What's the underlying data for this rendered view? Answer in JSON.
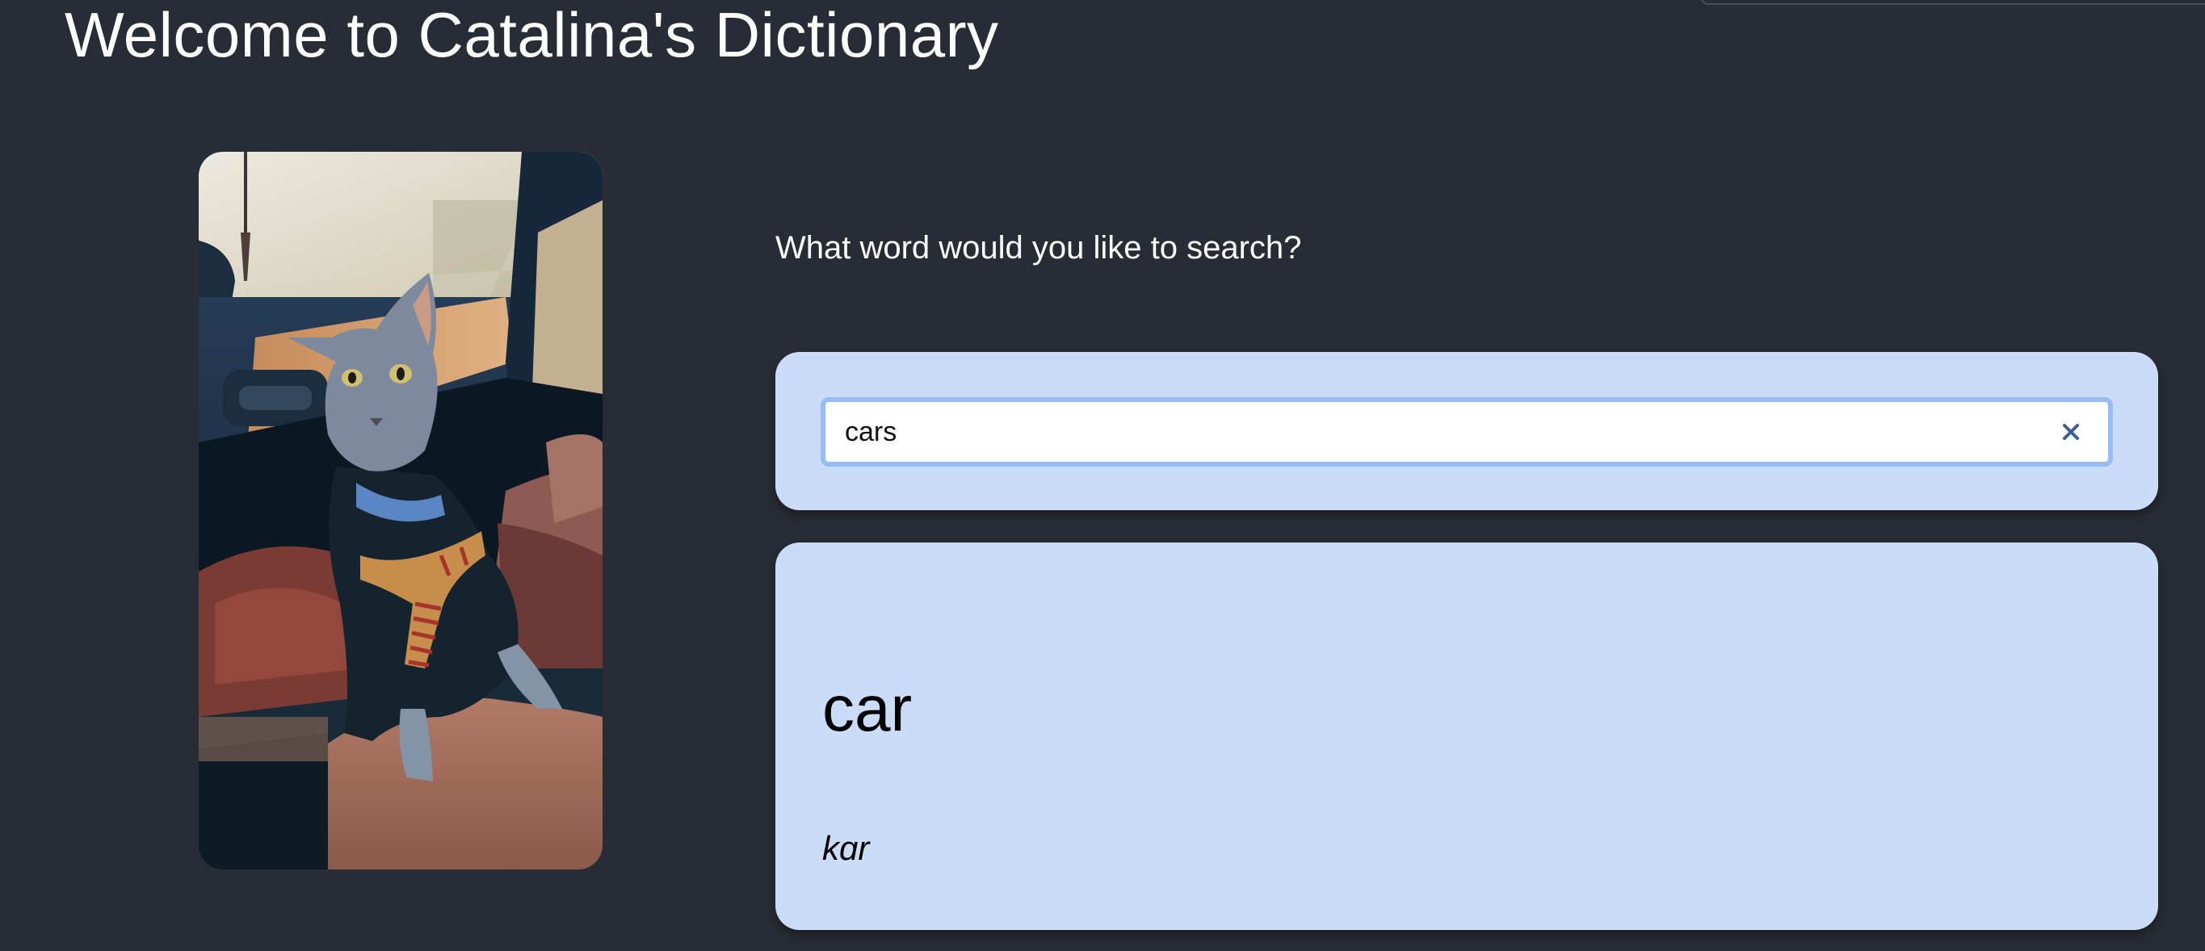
{
  "page": {
    "title": "Welcome to Catalina's Dictionary",
    "background": "#282c34"
  },
  "photo": {
    "alt": "Catalina the cat",
    "icon": "cat-photo"
  },
  "search": {
    "prompt": "What word would you like to search?",
    "value": "cars",
    "placeholder": "",
    "clear_icon": "close-icon",
    "card_color": "#cadcf8",
    "focus_border_color": "#98bdf4",
    "clear_icon_color": "#3d5f8f"
  },
  "result": {
    "word": "car",
    "phonetic": "kɑr",
    "card_color": "#cadcf8"
  }
}
